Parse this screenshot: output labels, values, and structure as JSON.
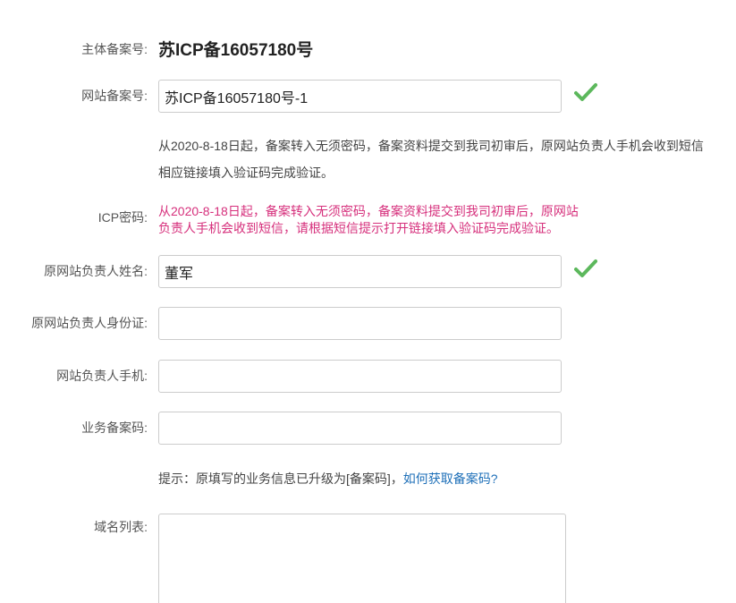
{
  "form": {
    "entity_filing": {
      "label": "主体备案号:",
      "value": "苏ICP备16057180号"
    },
    "site_filing": {
      "label": "网站备案号:",
      "value": "苏ICP备16057180号-1",
      "notice_line1": "从2020-8-18日起，备案转入无须密码，备案资料提交到我司初审后，原网站负责人手机会收到短信",
      "notice_line2": "相应链接填入验证码完成验证。"
    },
    "icp_password": {
      "label": "ICP密码:",
      "message_line1": "从2020-8-18日起，备案转入无须密码，备案资料提交到我司初审后，原网站",
      "message_line2": "负责人手机会收到短信，请根据短信提示打开链接填入验证码完成验证。"
    },
    "owner_name": {
      "label": "原网站负责人姓名:",
      "value": "董军"
    },
    "owner_id": {
      "label": "原网站负责人身份证:",
      "value": ""
    },
    "owner_phone": {
      "label": "网站负责人手机:",
      "value": ""
    },
    "business_code": {
      "label": "业务备案码:",
      "value": "",
      "hint_text": "提示：原填写的业务信息已升级为[备案码]，",
      "hint_link": "如何获取备案码?"
    },
    "domain_list": {
      "label": "域名列表:",
      "value": ""
    }
  },
  "colors": {
    "check": "#5cb85c",
    "icp_message": "#d6307c",
    "link": "#1d6fb8"
  },
  "icons": {
    "valid": "check-icon"
  }
}
